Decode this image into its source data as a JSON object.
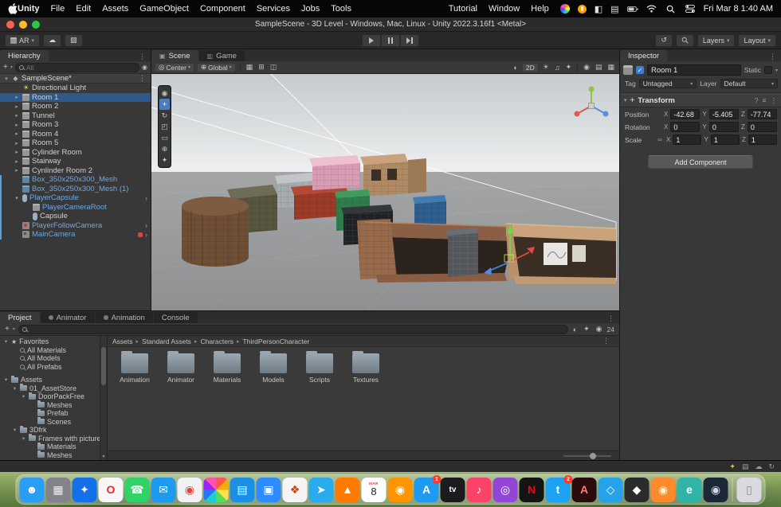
{
  "accent_colors": {
    "selection_blue": "#2d5a8a",
    "prefab_blue": "#6fa8e0",
    "tool_highlight": "#4a7dc0"
  },
  "icons": {
    "undo": "↺",
    "fold_open": "▾",
    "fold_closed": "▸",
    "plus": "+",
    "kebab": "⋮",
    "cloud": "☁",
    "image": "▨",
    "sun": "☀",
    "note": "♫",
    "sphere": "◐",
    "fx_star": "✦",
    "eye": "◉",
    "grid": "▦",
    "snap": "⊞",
    "magnet": "◫",
    "menu": "≡",
    "help": "?",
    "link": "∞",
    "chevron": "›",
    "scene_tab": "▣",
    "game_tab": "▥",
    "pivot": "◎",
    "globe": "⊕",
    "camera_overlay": "▤"
  },
  "menubar": {
    "items_left": [
      "Unity",
      "File",
      "Edit",
      "Assets",
      "GameObject",
      "Component",
      "Services",
      "Jobs",
      "Tools"
    ],
    "items_right": [
      "Tutorial",
      "Window",
      "Help"
    ],
    "clock": "Fri Mar 8 1:40 AM"
  },
  "titlebar": {
    "title": "SampleScene - 3D Level - Windows, Mac, Linux - Unity 2022.3.16f1 <Metal>"
  },
  "toolbar": {
    "ar_label": "AR",
    "layers_label": "Layers",
    "layout_label": "Layout"
  },
  "hierarchy": {
    "tab": "Hierarchy",
    "search_placeholder": "All",
    "scene_name": "SampleScene*",
    "items": [
      {
        "l": "Directional Light",
        "i": 1,
        "ic": "light"
      },
      {
        "l": "Room 1",
        "i": 1,
        "ic": "cube",
        "ar": 2,
        "sel": 1
      },
      {
        "l": "Room 2",
        "i": 1,
        "ic": "cube",
        "ar": 2
      },
      {
        "l": "Tunnel",
        "i": 1,
        "ic": "cube",
        "ar": 2
      },
      {
        "l": "Room 3",
        "i": 1,
        "ic": "cube",
        "ar": 2
      },
      {
        "l": "Room 4",
        "i": 1,
        "ic": "cube",
        "ar": 2
      },
      {
        "l": "Room 5",
        "i": 1,
        "ic": "cube",
        "ar": 2
      },
      {
        "l": "Cylinder Room",
        "i": 1,
        "ic": "cube",
        "ar": 2
      },
      {
        "l": "Stairway",
        "i": 1,
        "ic": "cube",
        "ar": 2
      },
      {
        "l": "Cynlinder Room 2",
        "i": 1,
        "ic": "cube",
        "ar": 2
      },
      {
        "l": "Box_350x250x300_Mesh",
        "i": 1,
        "ic": "mesh",
        "blue": 1,
        "bar": 1
      },
      {
        "l": "Box_350x250x300_Mesh (1)",
        "i": 1,
        "ic": "mesh",
        "blue": 1,
        "bar": 1
      },
      {
        "l": "PlayerCapsule",
        "i": 1,
        "ic": "capsule",
        "blue": 1,
        "bar": 1,
        "ar": 1,
        "px": 1
      },
      {
        "l": "PlayerCameraRoot",
        "i": 2,
        "ic": "cube",
        "blue": 1,
        "bar": 1
      },
      {
        "l": "Capsule",
        "i": 2,
        "ic": "capsule",
        "bar": 1
      },
      {
        "l": "PlayerFollowCamera",
        "i": 1,
        "ic": "vcam",
        "blue": 1,
        "bar": 1,
        "px": 1
      },
      {
        "l": "MainCamera",
        "i": 1,
        "ic": "camera",
        "blue": 1,
        "bar": 1,
        "px": 1,
        "red": 1
      }
    ]
  },
  "scene": {
    "tab_scene": "Scene",
    "tab_game": "Game",
    "pivot_label": "Center",
    "axis_label": "Global",
    "two_d": "2D",
    "tools": [
      {
        "name": "view-tool",
        "glyph": "◉"
      },
      {
        "name": "move-tool",
        "glyph": "+",
        "selected": true
      },
      {
        "name": "rotate-tool",
        "glyph": "↻"
      },
      {
        "name": "scale-tool",
        "glyph": "◰"
      },
      {
        "name": "rect-tool",
        "glyph": "▭"
      },
      {
        "name": "transform-tool",
        "glyph": "⊕"
      },
      {
        "name": "custom-tool",
        "glyph": "✦"
      }
    ]
  },
  "inspector": {
    "tab": "Inspector",
    "name": "Room 1",
    "static_label": "Static",
    "tag_label": "Tag",
    "tag_value": "Untagged",
    "layer_label": "Layer",
    "layer_value": "Default",
    "axis": {
      "x": "X",
      "y": "Y",
      "z": "Z"
    },
    "transform": {
      "title": "Transform",
      "position": {
        "label": "Position",
        "x": "-42.68",
        "y": "-5.405",
        "z": "-77.74"
      },
      "rotation": {
        "label": "Rotation",
        "x": "0",
        "y": "0",
        "z": "0"
      },
      "scale": {
        "label": "Scale",
        "x": "1",
        "y": "1",
        "z": "1"
      }
    },
    "add_component": "Add Component"
  },
  "project": {
    "tabs": [
      {
        "label": "Project",
        "active": true
      },
      {
        "label": "Animator",
        "dot": true
      },
      {
        "label": "Animation",
        "dot": true
      },
      {
        "label": "Console"
      }
    ],
    "hidden_count": "24",
    "tree": [
      {
        "l": "Favorites",
        "i": 0,
        "ic": "star",
        "ar": 1
      },
      {
        "l": "All Materials",
        "i": 1,
        "ic": "search"
      },
      {
        "l": "All Models",
        "i": 1,
        "ic": "search"
      },
      {
        "l": "All Prefabs",
        "i": 1,
        "ic": "search"
      },
      {
        "sp": 1
      },
      {
        "l": "Assets",
        "i": 0,
        "ic": "folder",
        "ar": 1
      },
      {
        "l": "01_AssetStore",
        "i": 1,
        "ic": "folder",
        "ar": 1
      },
      {
        "l": "DoorPackFree",
        "i": 2,
        "ic": "folder",
        "ar": 1
      },
      {
        "l": "Meshes",
        "i": 3,
        "ic": "folder"
      },
      {
        "l": "Prefab",
        "i": 3,
        "ic": "folder"
      },
      {
        "l": "Scenes",
        "i": 3,
        "ic": "folder"
      },
      {
        "l": "3Dfrk",
        "i": 1,
        "ic": "folder",
        "ar": 1
      },
      {
        "l": "Frames with pictures",
        "i": 2,
        "ic": "folder",
        "ar": 1
      },
      {
        "l": "Materials",
        "i": 3,
        "ic": "folder"
      },
      {
        "l": "Meshes",
        "i": 3,
        "ic": "folder"
      }
    ],
    "breadcrumb": [
      "Assets",
      "Standard Assets",
      "Characters",
      "ThirdPersonCharacter"
    ],
    "folders": [
      "Animation",
      "Animator",
      "Materials",
      "Models",
      "Scripts",
      "Textures"
    ]
  },
  "dock": {
    "items": [
      {
        "n": "finder",
        "k": "app",
        "bg": "#2a9df4",
        "fg": "#ffffff",
        "g": "☻"
      },
      {
        "n": "launchpad",
        "k": "app",
        "bg": "#83838b",
        "fg": "#f0f0f0",
        "g": "▦"
      },
      {
        "n": "safari",
        "k": "app",
        "bg": "#1470e8",
        "fg": "#ffffff",
        "g": "✦"
      },
      {
        "n": "opera",
        "k": "app",
        "bg": "#f7f7f7",
        "fg": "#ff1b2d",
        "g": "O"
      },
      {
        "n": "whatsapp",
        "k": "app",
        "bg": "#2fd366",
        "fg": "#ffffff",
        "g": "☎"
      },
      {
        "n": "mail",
        "k": "app",
        "bg": "#1e9bf0",
        "fg": "#ffffff",
        "g": "✉"
      },
      {
        "n": "red-media-app",
        "k": "app",
        "bg": "#f2f2f4",
        "fg": "#e0453a",
        "g": "◉"
      },
      {
        "n": "photos",
        "k": "pinwheel",
        "bg": "#ffffff",
        "fg": "#ffffff",
        "g": ""
      },
      {
        "n": "keynote",
        "k": "app",
        "bg": "#1a8fe3",
        "fg": "#ffffff",
        "g": "▤"
      },
      {
        "n": "zoom",
        "k": "app",
        "bg": "#2d8cff",
        "fg": "#ffffff",
        "g": "▣"
      },
      {
        "n": "office-app",
        "k": "app",
        "bg": "#f5f5f5",
        "fg": "#d83b01",
        "g": "❖"
      },
      {
        "n": "telegram",
        "k": "app",
        "bg": "#2aabee",
        "fg": "#ffffff",
        "g": "➤"
      },
      {
        "n": "vlc",
        "k": "app",
        "bg": "#ff7b00",
        "fg": "#ffffff",
        "g": "▲"
      },
      {
        "n": "calendar",
        "k": "calendar",
        "bg": "#ffffff",
        "fg": "#222222",
        "g": "8",
        "sub": "MAR"
      },
      {
        "n": "orange-app",
        "k": "app",
        "bg": "#ff9500",
        "fg": "#ffffff",
        "g": "◉"
      },
      {
        "n": "app-store",
        "k": "app",
        "bg": "#1e9bf0",
        "fg": "#ffffff",
        "g": "A",
        "badge": "1"
      },
      {
        "n": "apple-tv",
        "k": "app",
        "bg": "#1c1c1e",
        "fg": "#ffffff",
        "g": "tv"
      },
      {
        "n": "music",
        "k": "app",
        "bg": "#fb4268",
        "fg": "#ffffff",
        "g": "♪"
      },
      {
        "n": "podcasts",
        "k": "app",
        "bg": "#9146d8",
        "fg": "#ffffff",
        "g": "◎"
      },
      {
        "n": "netflix",
        "k": "app",
        "bg": "#141414",
        "fg": "#e50914",
        "g": "N"
      },
      {
        "n": "twitter",
        "k": "app",
        "bg": "#1da1f2",
        "fg": "#ffffff",
        "g": "t",
        "badge": "2"
      },
      {
        "n": "adobe-app",
        "k": "app",
        "bg": "#2b0c0c",
        "fg": "#ff7a7a",
        "g": "A"
      },
      {
        "n": "vscode",
        "k": "app",
        "bg": "#24a3e8",
        "fg": "#ffffff",
        "g": "◇"
      },
      {
        "n": "unity-hub",
        "k": "app",
        "bg": "#2b2b2b",
        "fg": "#ffffff",
        "g": "◆"
      },
      {
        "n": "firefox",
        "k": "app",
        "bg": "#ff8a2a",
        "fg": "#fff3d6",
        "g": "◉"
      },
      {
        "n": "edge",
        "k": "app",
        "bg": "#2fb4a6",
        "fg": "#ffffff",
        "g": "e"
      },
      {
        "n": "steam",
        "k": "app",
        "bg": "#1b2838",
        "fg": "#cdd9e5",
        "g": "◉"
      },
      {
        "n": "trash",
        "k": "trash",
        "bg": "#d9d9df",
        "fg": "#8a8a92",
        "g": "▯",
        "sep": true
      }
    ]
  }
}
